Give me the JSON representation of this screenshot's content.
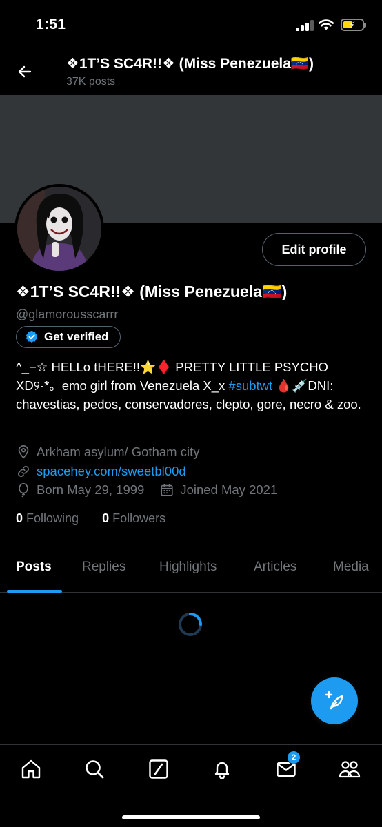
{
  "status_bar": {
    "time": "1:51"
  },
  "header": {
    "title": "❖1T’S SC4R!!❖ (Miss Penezuela🇻🇪)",
    "post_count": "37K posts"
  },
  "profile": {
    "display_name": "❖1T’S SC4R!!❖ (Miss Penezuela🇻🇪)",
    "handle": "@glamorousscarrr",
    "edit_label": "Edit profile",
    "verify_label": "Get verified",
    "bio_text": "^_−☆ HELLo tHERE!!⭐♦️ PRETTY LITTLE PSYCHO XD୨·*。emo girl from Venezuela X_x ",
    "bio_hashtag": "#subtwt",
    "bio_end": " 🩸💉DNI: chavestias, pedos, conservadores, clepto, gore, necro & zoo.",
    "location": "Arkham asylum/ Gotham city",
    "website": "spacehey.com/sweetbl00d",
    "birthday": "Born May 29, 1999",
    "joined": "Joined May 2021",
    "following_count": "0",
    "following_label": " Following",
    "followers_count": "0",
    "followers_label": " Followers"
  },
  "tabs": [
    {
      "label": "Posts",
      "active": true
    },
    {
      "label": "Replies"
    },
    {
      "label": "Highlights"
    },
    {
      "label": "Articles"
    },
    {
      "label": "Media"
    }
  ],
  "bottom_nav": {
    "items": [
      "home-icon",
      "search-icon",
      "grok-icon",
      "notifications-icon",
      "messages-icon",
      "communities-icon"
    ],
    "messages_badge": "2"
  },
  "colors": {
    "accent": "#1d9bf0",
    "background": "#000000",
    "banner": "#333639",
    "muted": "#71767b"
  }
}
